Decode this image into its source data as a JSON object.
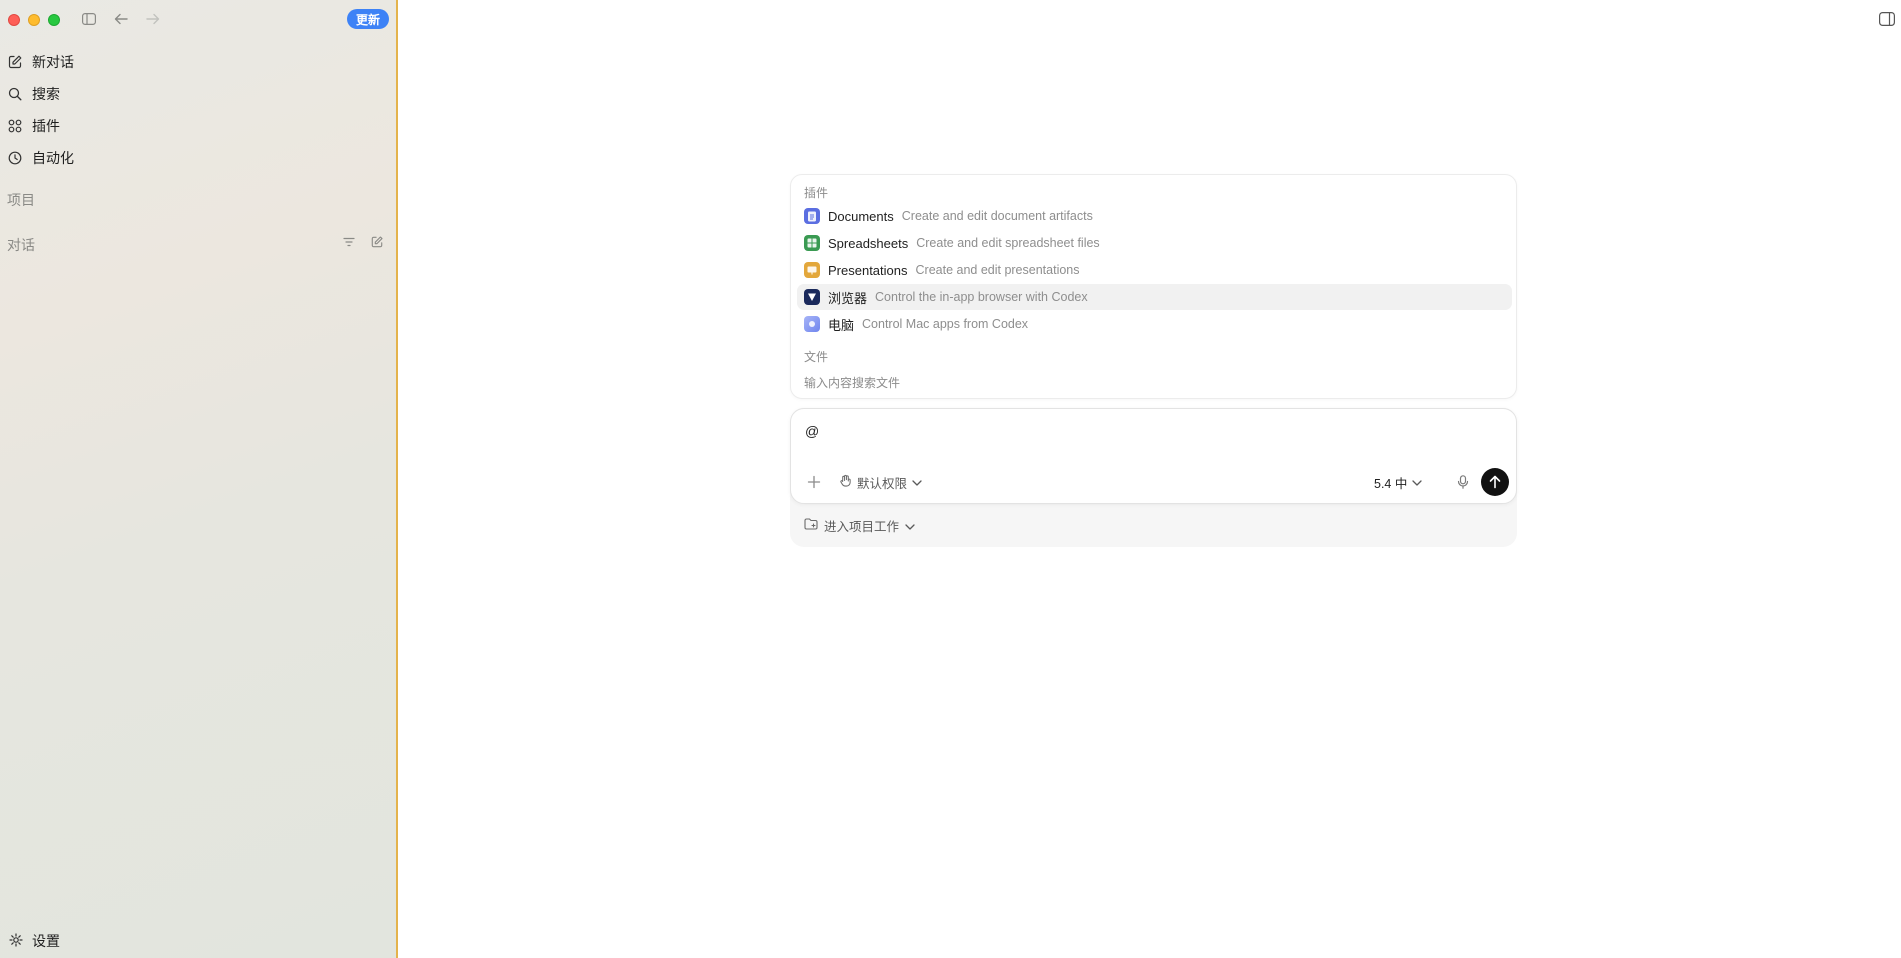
{
  "sidebar": {
    "update_label": "更新",
    "nav": [
      {
        "label": "新对话",
        "icon": "compose-icon"
      },
      {
        "label": "搜索",
        "icon": "search-icon"
      },
      {
        "label": "插件",
        "icon": "grid-icon"
      },
      {
        "label": "自动化",
        "icon": "clock-icon"
      }
    ],
    "projects_label": "项目",
    "conversations_label": "对话",
    "settings_label": "设置"
  },
  "popup": {
    "plugins_label": "插件",
    "items": [
      {
        "name": "Documents",
        "desc": "Create and edit document artifacts",
        "icon": "documents-icon",
        "color": "#5b6ee1"
      },
      {
        "name": "Spreadsheets",
        "desc": "Create and edit spreadsheet files",
        "icon": "spreadsheets-icon",
        "color": "#3a9a52"
      },
      {
        "name": "Presentations",
        "desc": "Create and edit presentations",
        "icon": "presentations-icon",
        "color": "#e3a73b"
      },
      {
        "name": "浏览器",
        "desc": "Control the in-app browser with Codex",
        "icon": "browser-icon",
        "color": "#1b2a5c"
      },
      {
        "name": "电脑",
        "desc": "Control Mac apps from Codex",
        "icon": "computer-icon",
        "color": "#8c9bf0"
      }
    ],
    "files_label": "文件",
    "files_hint": "输入内容搜索文件"
  },
  "composer": {
    "input_value": "@",
    "permission_label": "默认权限",
    "model_label": "5.4 中",
    "project_label": "进入项目工作"
  },
  "colors": {
    "accent": "#3d82f6",
    "sidebar_border": "#e4b34c"
  }
}
